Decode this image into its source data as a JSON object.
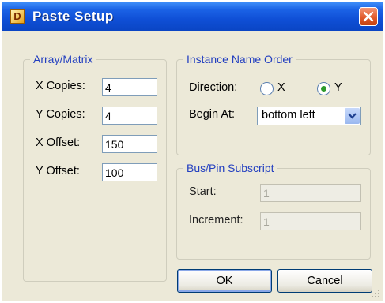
{
  "window": {
    "title": "Paste Setup",
    "icon_letter": "D"
  },
  "array_matrix": {
    "legend": "Array/Matrix",
    "x_copies": {
      "label": "X Copies:",
      "value": "4"
    },
    "y_copies": {
      "label": "Y Copies:",
      "value": "4"
    },
    "x_offset": {
      "label": "X Offset:",
      "value": "150"
    },
    "y_offset": {
      "label": "Y Offset:",
      "value": "100"
    }
  },
  "instance_name_order": {
    "legend": "Instance Name Order",
    "direction_label": "Direction:",
    "options": [
      {
        "label": "X",
        "selected": false
      },
      {
        "label": "Y",
        "selected": true
      }
    ],
    "begin_at_label": "Begin At:",
    "begin_at_value": "bottom left"
  },
  "bus_pin_subscript": {
    "legend": "Bus/Pin Subscript",
    "start": {
      "label": "Start:",
      "value": "1"
    },
    "increment": {
      "label": "Increment:",
      "value": "1"
    }
  },
  "buttons": {
    "ok": "OK",
    "cancel": "Cancel"
  }
}
